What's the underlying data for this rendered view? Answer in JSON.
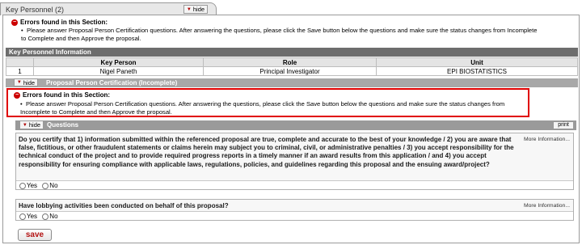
{
  "tab": {
    "title": "Key Personnel (2)",
    "hide_label": "hide"
  },
  "section_errors": {
    "heading": "Errors found in this Section:",
    "message": "Please answer Proposal Person Certification questions. After answering the questions, please click the Save button below the questions and make sure the status changes from Incomplete to Complete and then Approve the proposal."
  },
  "key_personnel": {
    "header": "Key Personnel Information",
    "columns": [
      "",
      "Key Person",
      "Role",
      "Unit"
    ],
    "rows": [
      {
        "index": "1",
        "person": "Nigel Paneth",
        "role": "Principal Investigator",
        "unit": "EPI BIOSTATISTICS"
      }
    ]
  },
  "certification": {
    "hide_label": "hide",
    "title": "Proposal Person Certification (Incomplete)",
    "error_heading": "Errors found in this Section:",
    "error_message": "Please answer Proposal Person Certification questions. After answering the questions, please click the Save button below the questions and make sure the status changes from Incomplete to Complete and then Approve the proposal."
  },
  "questions": {
    "hide_label": "hide",
    "title": "Questions",
    "print_label": "print",
    "items": [
      {
        "text": "Do you certify that 1) information submitted within the referenced proposal are true, complete and accurate to the best of your knowledge / 2) you are aware that false, fictitious, or other fraudulent statements or claims herein may subject you to criminal, civil, or administrative penalties / 3) you accept responsibility for the technical conduct of the project and to provide required progress reports in a timely manner if an award results from this application / and 4) you accept responsibility for ensuring compliance with applicable laws, regulations, policies, and guidelines regarding this proposal and the ensuing award/project?",
        "more_info": "More Information...",
        "yes": "Yes",
        "no": "No"
      },
      {
        "text": "Have lobbying activities been conducted on behalf of this proposal?",
        "more_info": "More Information...",
        "yes": "Yes",
        "no": "No"
      }
    ]
  },
  "save_label": "save",
  "colors": {
    "error_red": "#e00000",
    "header_gray": "#6d6d6d",
    "save_text": "#b41313"
  }
}
